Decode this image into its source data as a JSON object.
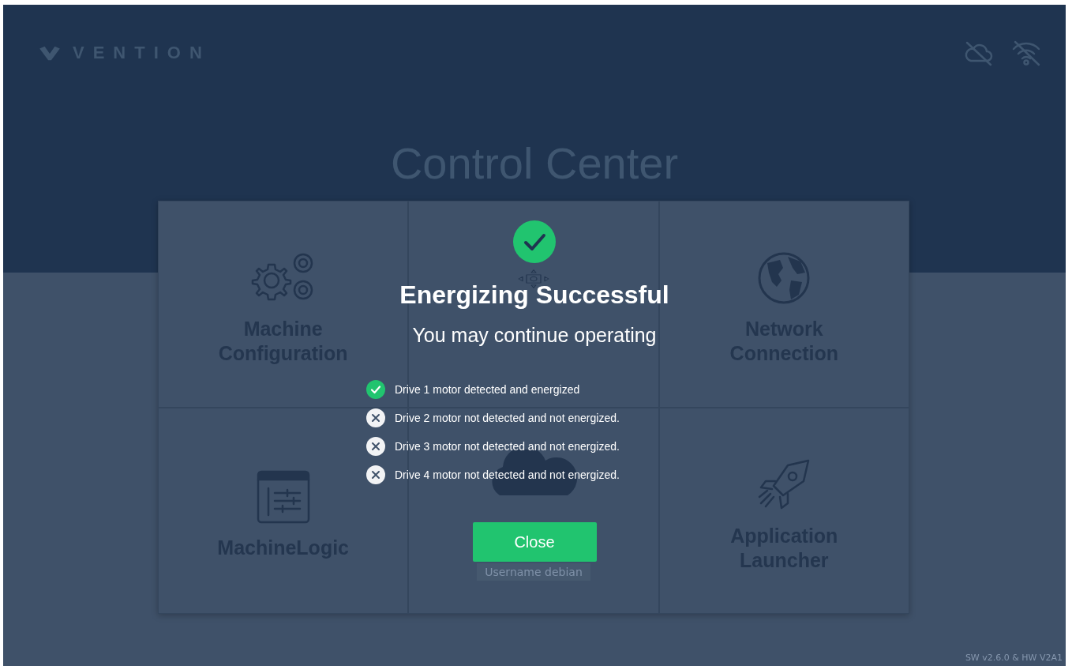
{
  "header": {
    "logo_text": "VENTION"
  },
  "page_title": "Control Center",
  "tiles": [
    {
      "kind": "gears",
      "title": "Machine Configuration"
    },
    {
      "kind": "dpad"
    },
    {
      "kind": "globe",
      "title": "Network Connection"
    },
    {
      "kind": "app-window",
      "title": "MachineLogic"
    },
    {
      "kind": "cloud",
      "caption": "Username debian"
    },
    {
      "kind": "rocket",
      "title": "Application Launcher"
    }
  ],
  "version": "SW v2.6.0 & HW V2A1",
  "dialog": {
    "title": "Energizing Successful",
    "subtitle": "You may continue operating",
    "items": [
      {
        "energized": true,
        "text": "Drive 1 motor detected and energized"
      },
      {
        "energized": false,
        "text": "Drive 2 motor not detected and not energized."
      },
      {
        "energized": false,
        "text": "Drive 3 motor not detected and not energized."
      },
      {
        "energized": false,
        "text": "Drive 4 motor not detected and not energized."
      }
    ],
    "button": "Close"
  }
}
